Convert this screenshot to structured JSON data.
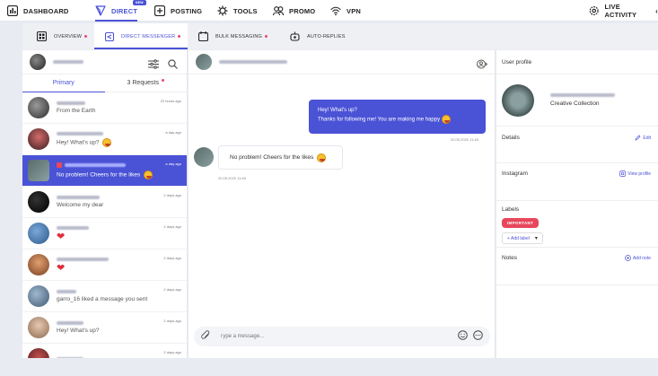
{
  "nav": {
    "dashboard": "DASHBOARD",
    "direct": "DIRECT",
    "direct_badge": "NEW",
    "posting": "POSTING",
    "tools": "TOOLS",
    "promo": "PROMO",
    "vpn": "VPN",
    "live_activity": "LIVE ACTIVITY",
    "accent": "#4a52d6"
  },
  "subnav": {
    "overview": "OVERVIEW",
    "direct_messenger": "DIRECT MESSENGER",
    "bulk_messaging": "BULK MESSAGING",
    "auto_replies": "AUTO-REPLIES"
  },
  "inbox": {
    "tab_primary": "Primary",
    "tab_requests": "3 Requests",
    "conversations": [
      {
        "message": "From the Earth",
        "time": "22 hours ago",
        "heart": false
      },
      {
        "message": "Hey! What's up?",
        "time": "a day ago",
        "heart": false
      },
      {
        "message": "No problem! Cheers for the likes",
        "time": "a day ago",
        "heart": false,
        "active": true
      },
      {
        "message": "Welcome my dear",
        "time": "2 days ago",
        "heart": false
      },
      {
        "message": "",
        "time": "2 days ago",
        "heart": true
      },
      {
        "message": "",
        "time": "2 days ago",
        "heart": true
      },
      {
        "message": "garro_16 liked a message you sent",
        "time": "2 days ago",
        "heart": false
      },
      {
        "message": "Hey! What's up?",
        "time": "2 days ago",
        "heart": false
      },
      {
        "message": "",
        "time": "2 days ago",
        "heart": false
      }
    ]
  },
  "chat": {
    "outgoing_line1": "Hey! What's up?",
    "outgoing_line2": "Thanks for following me! You are making me happy",
    "outgoing_time": "20.05.2020 11:45",
    "incoming_text": "No problem! Cheers for the likes",
    "incoming_time": "20.05.2020 11:48",
    "input_placeholder": "Type a message..."
  },
  "profile": {
    "title": "User profile",
    "name": "Creative Collection",
    "details": "Details",
    "edit": "Edit",
    "instagram": "Instagram",
    "view_profile": "View profile",
    "labels": "Labels",
    "label_important": "IMPORTANT",
    "add_label": "+ Add label",
    "notes": "Notes",
    "add_note": "Add note"
  }
}
